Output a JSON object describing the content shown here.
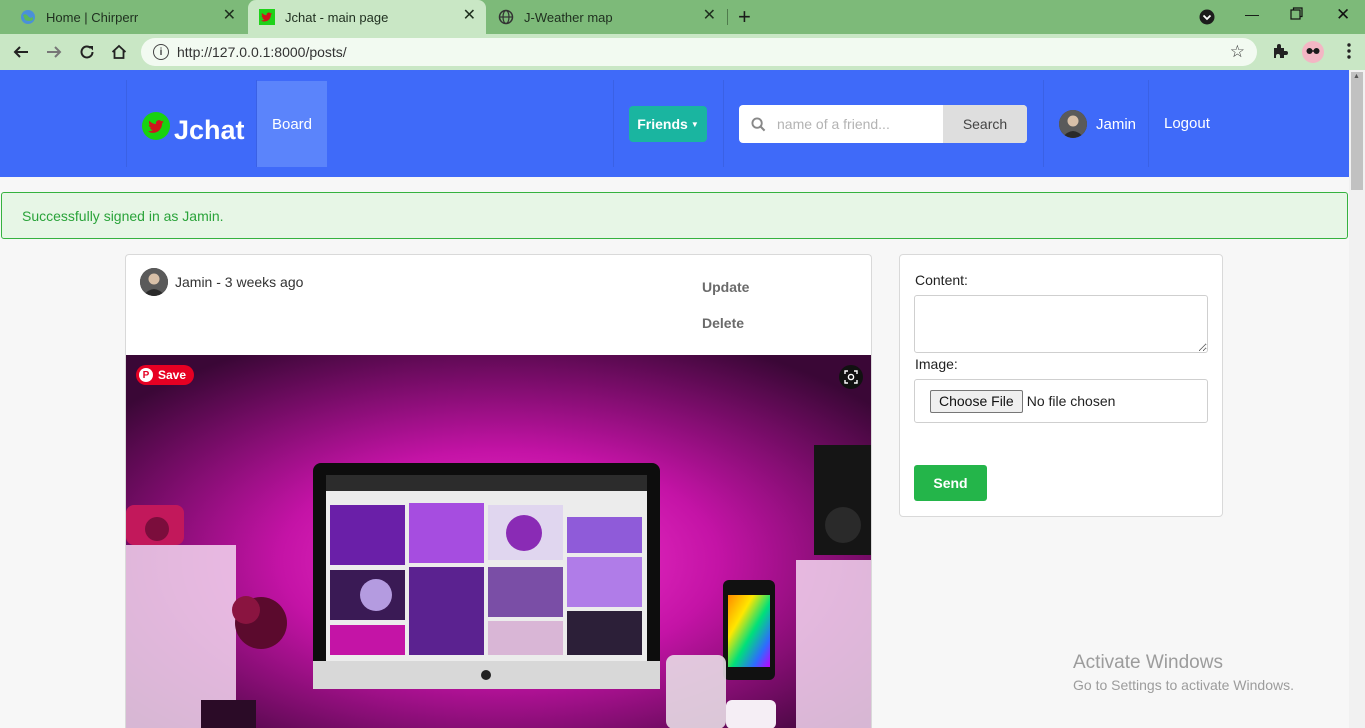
{
  "browser": {
    "tabs": [
      {
        "title": "Home | Chirperr",
        "icon": "globe-favicon"
      },
      {
        "title": "Jchat - main page",
        "icon": "twitter-bird-favicon",
        "active": true
      },
      {
        "title": "J-Weather map",
        "icon": "globe-favicon"
      }
    ],
    "url": "http://127.0.0.1:8000/posts/"
  },
  "navbar": {
    "brand": "Jchat",
    "board_label": "Board",
    "friends_label": "Friends",
    "search_placeholder": "name of a friend...",
    "search_button": "Search",
    "username": "Jamin",
    "logout_label": "Logout",
    "accent": "#3f6af9"
  },
  "alert": {
    "message": "Successfully signed in as Jamin."
  },
  "post": {
    "author_line": "Jamin - 3 weeks ago",
    "update_label": "Update",
    "delete_label": "Delete",
    "pin_save_label": "Save",
    "image_desc_icon": "desk-setup-photo"
  },
  "form": {
    "content_label": "Content:",
    "image_label": "Image:",
    "choose_file_label": "Choose File",
    "no_file_label": "No file chosen",
    "send_label": "Send"
  },
  "watermark": {
    "title": "Activate Windows",
    "subtitle": "Go to Settings to activate Windows."
  }
}
